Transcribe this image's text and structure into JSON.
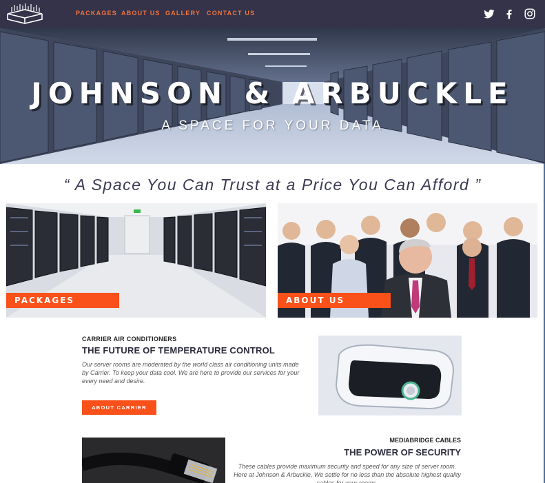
{
  "nav": {
    "links": [
      "PACKAGES",
      "ABOUT US",
      "GALLERY",
      "CONTACT US"
    ],
    "social": [
      "twitter-icon",
      "facebook-icon",
      "instagram-icon"
    ]
  },
  "hero": {
    "title": "JOHNSON & ARBUCKLE",
    "subtitle": "A SPACE FOR YOUR DATA"
  },
  "tagline": "“ A Space You Can Trust at a Price You Can Afford ”",
  "tiles": [
    {
      "label": "PACKAGES",
      "image": "server-room-photo"
    },
    {
      "label": "ABOUT US",
      "image": "team-photo"
    }
  ],
  "feature_carrier": {
    "eyebrow": "CARRIER AIR CONDITIONERS",
    "heading": "THE FUTURE OF TEMPERATURE CONTROL",
    "body": "Our server rooms are moderated by the world class air conditioning units made by Carrier. To keep your data cool. We are here to provide our services for your every need and desire.",
    "button": "ABOUT CARRIER"
  },
  "feature_cables": {
    "eyebrow": "MEDIABRIDGE CABLES",
    "heading": "THE POWER OF SECURITY",
    "body": "These cables provide maximum security and speed for any size of server room. Here at Johnson & Arbuckle, We settle for no less than the absolute highest quality cables for your rooms."
  },
  "colors": {
    "nav_bg": "#34334a",
    "accent": "#fa5019",
    "nav_link": "#f4733a"
  }
}
